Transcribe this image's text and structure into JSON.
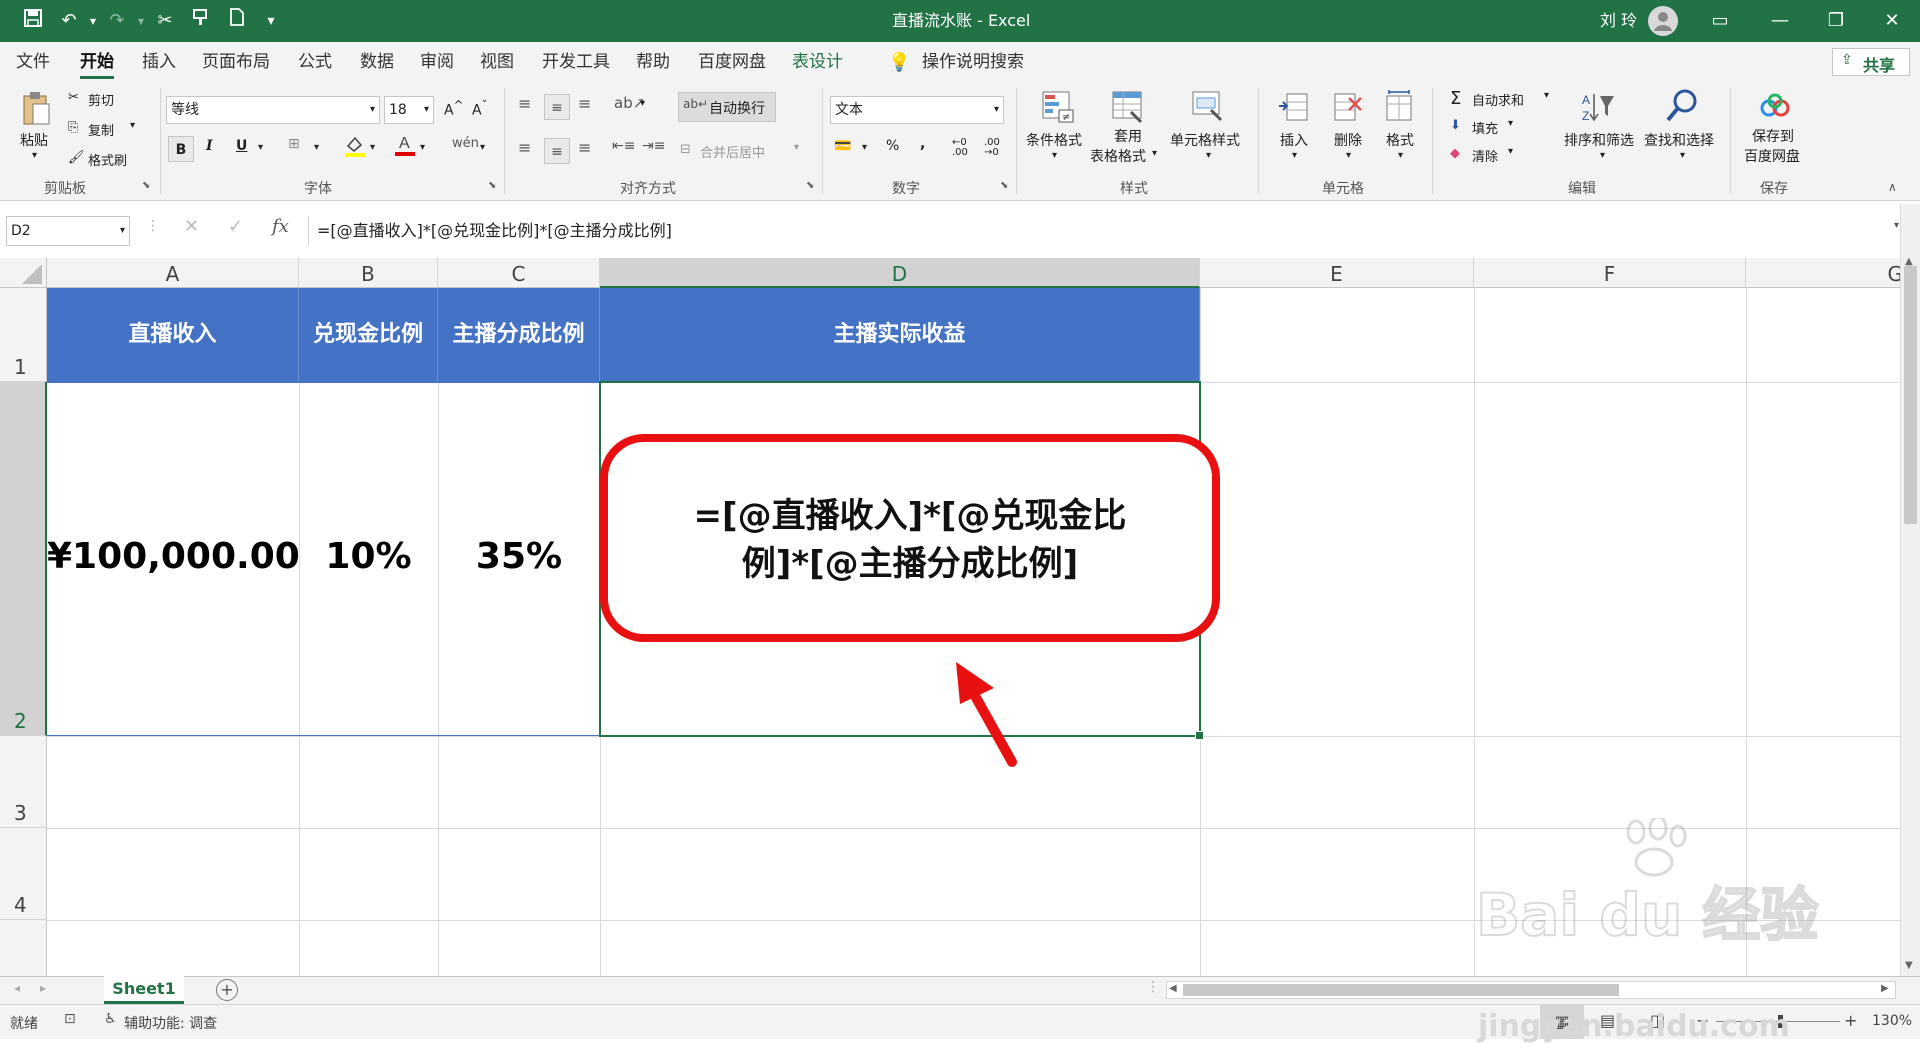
{
  "window": {
    "title": "直播流水账 - Excel",
    "user": "刘 玲"
  },
  "menu_tabs": [
    "文件",
    "开始",
    "插入",
    "页面布局",
    "公式",
    "数据",
    "审阅",
    "视图",
    "开发工具",
    "帮助",
    "百度网盘",
    "表设计"
  ],
  "tell_me": "操作说明搜索",
  "share": "共享",
  "ribbon": {
    "clipboard": {
      "paste": "粘贴",
      "cut": "剪切",
      "copy": "复制",
      "format_painter": "格式刷",
      "label": "剪贴板"
    },
    "font": {
      "name": "等线",
      "size": "18",
      "bold": "B",
      "italic": "I",
      "underline": "U",
      "label": "字体"
    },
    "alignment": {
      "wrap": "自动换行",
      "merge": "合并后居中",
      "label": "对齐方式"
    },
    "number": {
      "format": "文本",
      "percent": "%",
      "comma": ",",
      "label": "数字"
    },
    "styles": {
      "conditional": "条件格式",
      "table_fmt_1": "套用",
      "table_fmt_2": "表格格式",
      "cell_styles": "单元格样式",
      "label": "样式"
    },
    "cells": {
      "insert": "插入",
      "delete": "删除",
      "format": "格式",
      "label": "单元格"
    },
    "editing": {
      "autosum": "自动求和",
      "fill": "填充",
      "clear": "清除",
      "sort": "排序和筛选",
      "find": "查找和选择",
      "label": "编辑"
    },
    "save": {
      "label1": "保存到",
      "label2": "百度网盘",
      "label": "保存"
    }
  },
  "formula_bar": {
    "name_box": "D2",
    "fx": "fx",
    "formula": "=[@直播收入]*[@兑现金比例]*[@主播分成比例]"
  },
  "columns": [
    "A",
    "B",
    "C",
    "D",
    "E",
    "F",
    "G"
  ],
  "rows": [
    "1",
    "2",
    "3",
    "4"
  ],
  "table": {
    "headers": [
      "直播收入",
      "兑现金比例",
      "主播分成比例",
      "主播实际收益"
    ],
    "row2": [
      "¥100,000.00",
      "10%",
      "35%"
    ]
  },
  "callout": {
    "line1": "=[@直播收入]*[@兑现金比",
    "line2": "例]*[@主播分成比例]"
  },
  "sheet_tab": "Sheet1",
  "status": {
    "ready": "就绪",
    "accessibility": "辅助功能: 调查",
    "zoom": "130%"
  },
  "watermark": {
    "brand": "Bai du 经验",
    "url": "jingyan.baidu.com"
  },
  "colors": {
    "excel_green": "#217346",
    "header_blue": "#4472c4",
    "callout_red": "#e81010"
  }
}
